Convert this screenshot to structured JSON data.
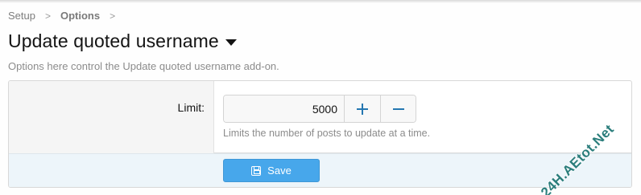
{
  "breadcrumb": {
    "items": [
      "Setup",
      "Options"
    ],
    "separator": ">"
  },
  "page": {
    "title": "Update quoted username",
    "description": "Options here control the Update quoted username add-on."
  },
  "option": {
    "label": "Limit:",
    "value": "5000",
    "increment_icon": "plus-icon",
    "decrement_icon": "minus-icon",
    "hint": "Limits the number of posts to update at a time."
  },
  "form": {
    "save_label": "Save",
    "save_icon": "save-icon"
  },
  "watermark": {
    "text": "24H.AEtot.Net"
  },
  "colors": {
    "accent": "#2577b1",
    "save_button": "#47a7eb",
    "submit_row_bg": "#edf5fa",
    "label_cell_bg": "#f5f5f5",
    "watermark": "#2a7d7b"
  }
}
